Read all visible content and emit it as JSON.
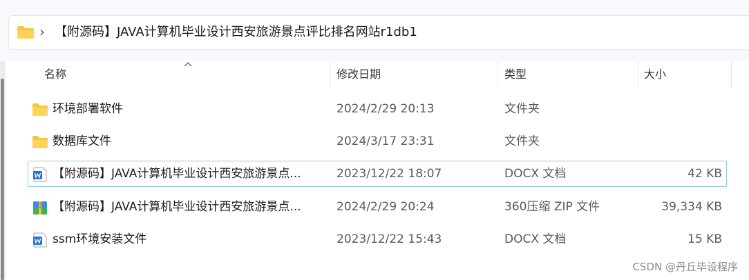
{
  "address_bar": {
    "chevron": "›",
    "path": "【附源码】JAVA计算机毕业设计西安旅游景点评比排名网站r1db1",
    "folder_icon": "folder-icon"
  },
  "columns": {
    "name": "名称",
    "modified": "修改日期",
    "type": "类型",
    "size": "大小"
  },
  "files": [
    {
      "name": "环境部署软件",
      "modified": "2024/2/29 20:13",
      "type": "文件夹",
      "size": "",
      "icon": "folder-icon"
    },
    {
      "name": "数据库文件",
      "modified": "2024/3/17 23:31",
      "type": "文件夹",
      "size": "",
      "icon": "folder-icon"
    },
    {
      "name": "【附源码】JAVA计算机毕业设计西安旅游景点...",
      "modified": "2023/12/22 18:07",
      "type": "DOCX 文档",
      "size": "42 KB",
      "icon": "word-document-icon",
      "selected": true
    },
    {
      "name": "【附源码】JAVA计算机毕业设计西安旅游景点...",
      "modified": "2024/2/29 20:24",
      "type": "360压缩 ZIP 文件",
      "size": "39,334 KB",
      "icon": "zip-archive-icon"
    },
    {
      "name": "ssm环境安装文件",
      "modified": "2023/12/22 15:43",
      "type": "DOCX 文档",
      "size": "15 KB",
      "icon": "word-document-icon"
    }
  ],
  "watermark": "CSDN @丹丘毕设程序",
  "colors": {
    "folder": "#f6c443",
    "word_blue": "#2b6fd6",
    "selection_border": "#93c7df"
  }
}
